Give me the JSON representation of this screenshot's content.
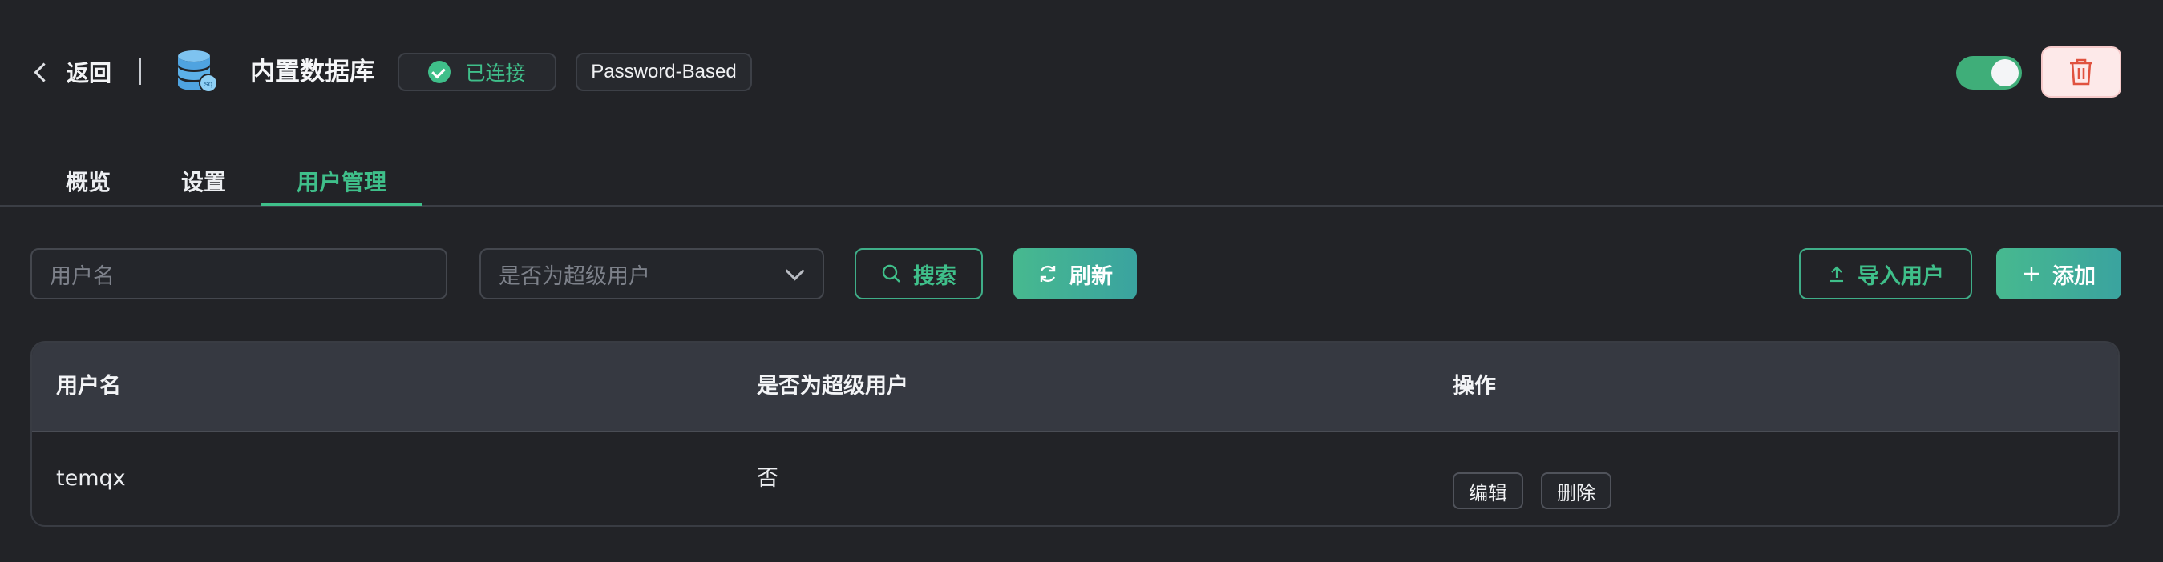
{
  "header": {
    "back_label": "返回",
    "title": "内置数据库",
    "status": "已连接",
    "auth_type": "Password-Based",
    "enabled": true
  },
  "tabs": [
    {
      "label": "概览"
    },
    {
      "label": "设置"
    },
    {
      "label": "用户管理",
      "active": true
    }
  ],
  "filters": {
    "username_placeholder": "用户名",
    "superuser_placeholder": "是否为超级用户",
    "search_label": "搜索",
    "refresh_label": "刷新",
    "import_label": "导入用户",
    "add_label": "添加"
  },
  "table": {
    "columns": [
      "用户名",
      "是否为超级用户",
      "操作"
    ],
    "rows": [
      {
        "username": "temqx",
        "is_superuser": "否",
        "actions": [
          "编辑",
          "删除"
        ]
      }
    ]
  },
  "colors": {
    "accent": "#3fbf8a",
    "background": "#222327",
    "danger_bg": "#fde9e9",
    "danger_icon": "#e0523f"
  }
}
